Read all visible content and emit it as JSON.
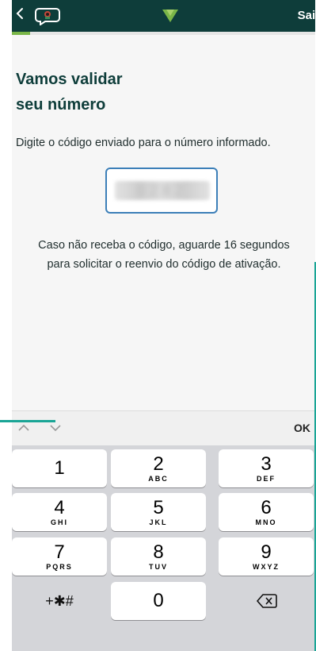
{
  "header": {
    "back_glyph": "<",
    "exit_label": "Sair",
    "brand_color": "#0e3d3a",
    "progress": 0.06
  },
  "content": {
    "title_line1": "Vamos validar",
    "title_line2": "seu número",
    "subtitle": "Digite o código enviado para o número informado.",
    "code_value": "0282",
    "info_line1": "Caso não receba o código, aguarde 16 segundos",
    "info_line2": "para solicitar o reenvio do código de ativação."
  },
  "keyboard": {
    "ok_label": "OK",
    "keys": [
      {
        "num": "1",
        "letters": ""
      },
      {
        "num": "2",
        "letters": "ABC"
      },
      {
        "num": "3",
        "letters": "DEF"
      },
      {
        "num": "4",
        "letters": "GHI"
      },
      {
        "num": "5",
        "letters": "JKL"
      },
      {
        "num": "6",
        "letters": "MNO"
      },
      {
        "num": "7",
        "letters": "PQRS"
      },
      {
        "num": "8",
        "letters": "TUV"
      },
      {
        "num": "9",
        "letters": "WXYZ"
      }
    ],
    "symbols_label": "+✱#",
    "zero_label": "0"
  },
  "icons": {
    "back": "chevron-left-icon",
    "chat": "chat-bubble-icon",
    "logo": "brand-v-logo-icon",
    "prev": "chevron-up-icon",
    "next": "chevron-down-icon",
    "delete": "backspace-icon"
  },
  "colors": {
    "accent_green": "#7ab648",
    "logo_green": "#7ab648",
    "input_border": "#3c7fb8",
    "teal_accent": "#1aa596"
  }
}
